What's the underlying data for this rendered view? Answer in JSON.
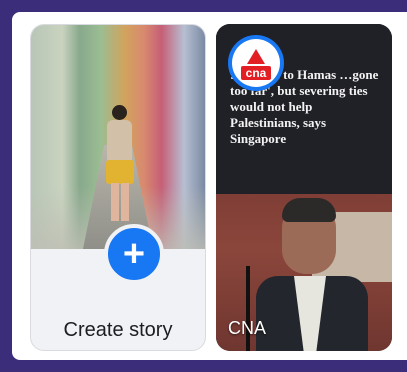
{
  "create_story": {
    "label": "Create story",
    "plus_symbol": "+",
    "icon": "plus-icon",
    "accent": "#1877f2"
  },
  "cna_story": {
    "label": "CNA",
    "logo_text": "cna",
    "headline": "…sponse to Hamas …gone too far', but severing ties would not help Palestinians, says Singapore",
    "logo_color": "#e31f26"
  },
  "colors": {
    "frame": "#3b2d7a",
    "card_background": "#f0f2f5"
  }
}
